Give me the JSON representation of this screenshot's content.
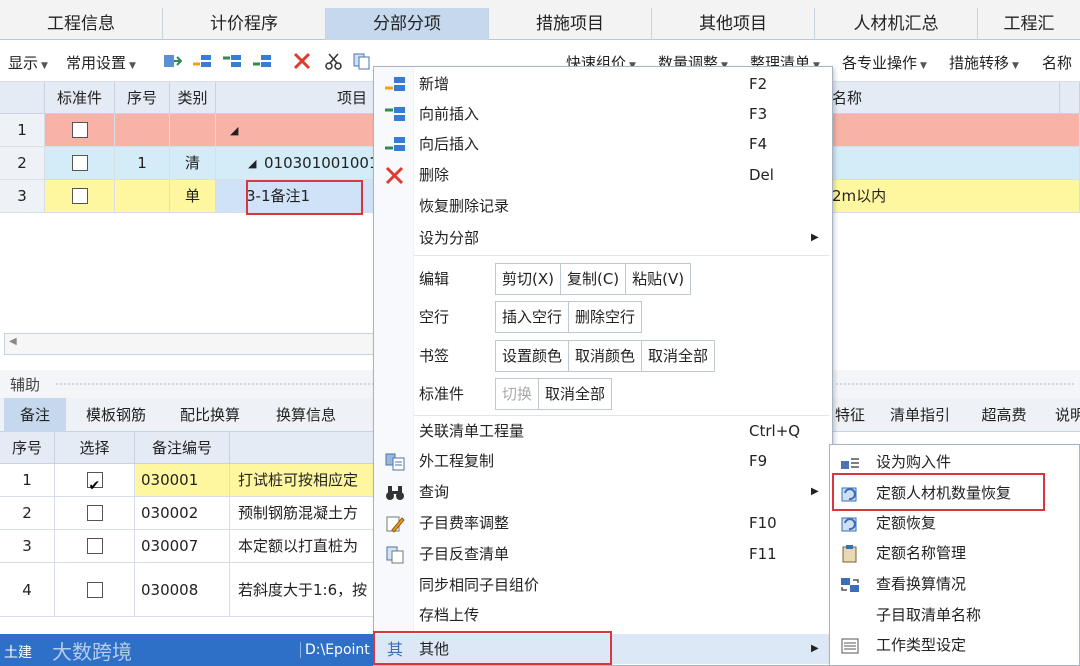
{
  "tabs": [
    "工程信息",
    "计价程序",
    "分部分项",
    "措施项目",
    "其他项目",
    "人材机汇总",
    "工程汇"
  ],
  "toolbar": {
    "display": "显示",
    "common_settings": "常用设置",
    "quick_price": "快速组价",
    "qty_adjust": "数量调整",
    "organize_list": "整理清单",
    "specialty_ops": "各专业操作",
    "measure_transfer": "措施转移",
    "name": "名称"
  },
  "grid": {
    "headers": [
      "标准件",
      "序号",
      "类别",
      "项目",
      "名称"
    ],
    "rows": [
      {
        "num": "1",
        "seq": "",
        "type": "",
        "code": "",
        "name": ""
      },
      {
        "num": "2",
        "seq": "1",
        "type": "清",
        "code": "010301001001",
        "name": ""
      },
      {
        "num": "3",
        "seq": "",
        "type": "单",
        "code": "3-1备注1",
        "name": "2m以内"
      }
    ]
  },
  "aux": {
    "title": "辅助",
    "tabs": [
      "备注",
      "模板钢筋",
      "配比换算",
      "换算信息",
      "特征",
      "清单指引",
      "超高费",
      "说明"
    ],
    "headers": [
      "序号",
      "选择",
      "备注编号"
    ],
    "rows": [
      {
        "num": "1",
        "checked": true,
        "code": "030001",
        "text": "打试桩可按相应定"
      },
      {
        "num": "2",
        "checked": false,
        "code": "030002",
        "text": "预制钢筋混凝土方"
      },
      {
        "num": "3",
        "checked": false,
        "code": "030007",
        "text": "本定额以打直桩为"
      },
      {
        "num": "4",
        "checked": false,
        "code": "030008",
        "text": "若斜度大于1:6，按"
      }
    ]
  },
  "status": {
    "left": "土建",
    "path": "D:\\Epoint",
    "watermark": "大数跨境"
  },
  "menu": {
    "add": {
      "label": "新增",
      "shortcut": "F2"
    },
    "insert_before": {
      "label": "向前插入",
      "shortcut": "F3"
    },
    "insert_after": {
      "label": "向后插入",
      "shortcut": "F4"
    },
    "delete": {
      "label": "删除",
      "shortcut": "Del"
    },
    "restore_deleted": "恢复删除记录",
    "set_section": "设为分部",
    "edit": {
      "label": "编辑",
      "cut": "剪切(X)",
      "copy": "复制(C)",
      "paste": "粘贴(V)"
    },
    "blank_row": {
      "label": "空行",
      "insert": "插入空行",
      "delete": "删除空行"
    },
    "bookmark": {
      "label": "书签",
      "set_color": "设置颜色",
      "cancel_color": "取消颜色",
      "cancel_all": "取消全部"
    },
    "standard_part": {
      "label": "标准件",
      "switch": "切换",
      "cancel_all": "取消全部"
    },
    "link_qty": {
      "label": "关联清单工程量",
      "shortcut": "Ctrl+Q"
    },
    "external_copy": {
      "label": "外工程复制",
      "shortcut": "F9"
    },
    "query": "查询",
    "rate_adjust": {
      "label": "子目费率调整",
      "shortcut": "F10"
    },
    "reverse_lookup": {
      "label": "子目反查清单",
      "shortcut": "F11"
    },
    "sync_price": "同步相同子目组价",
    "archive_upload": "存档上传",
    "other": "其他"
  },
  "submenu": {
    "purchase": "设为购入件",
    "restore_qty": "定额人材机数量恢复",
    "restore_quota": "定额恢复",
    "name_mgmt": "定额名称管理",
    "view_conv": "查看换算情况",
    "cancel_name": "子目取清单名称",
    "work_type": "工作类型设定"
  },
  "colors": {
    "accent": "#2e6fc7",
    "row_pink": "#f8b3a6",
    "row_blue": "#d4ecf8",
    "row_yellow": "#fff7a0",
    "highlight_red": "#d9363e"
  }
}
